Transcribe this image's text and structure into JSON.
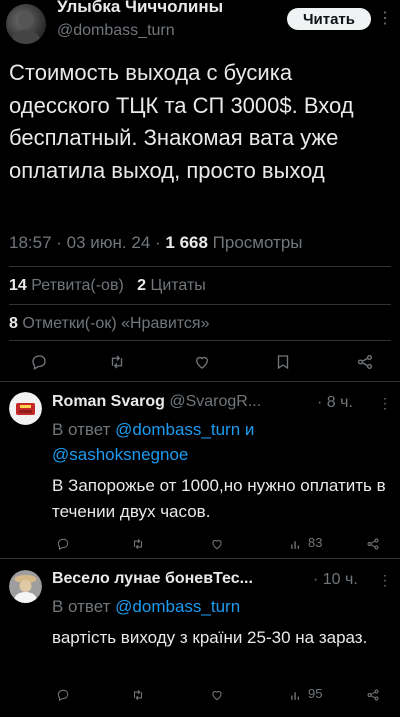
{
  "tweet": {
    "author_name": "Улыбка Чиччолины",
    "author_handle": "@dombass_turn",
    "read_button": "Читать",
    "text": "Стоимость выхода с бусика одесского ТЦК та СП 3000$. Вход бесплатный. Знакомая вата уже оплатила выход, просто выход",
    "time": "18:57 · 03 июн. 24 · ",
    "views_count": "1 668",
    "views_label": " Просмотры",
    "retweets_count": "14",
    "retweets_label": " Ретвита(-ов)",
    "quotes_count": "2",
    "quotes_label": " Цитаты",
    "likes_count": "8",
    "likes_label": " Отметки(-ок) «Нравится»"
  },
  "replies": [
    {
      "name": "Roman Svarog",
      "handle": " @SvarogR...",
      "time": "· 8 ч.",
      "reply_to_prefix": "В ответ ",
      "reply_to_1": "@dombass_turn",
      "reply_to_and": " и",
      "reply_to_2": "@sashoksnegnoe",
      "text": "В Запорожье от 1000,но нужно оплатить в течении двух часов.",
      "views": "83"
    },
    {
      "name": "Весело лунае боневТес...",
      "handle": "",
      "time": "· 10 ч.",
      "reply_to_prefix": "В ответ ",
      "reply_to_1": "@dombass_turn",
      "text": "вартість виходу з країни 25-30 на зараз.",
      "views": "95"
    }
  ],
  "colors": {
    "background": "#000000",
    "text": "#e7e9ea",
    "secondary": "#71767b",
    "link": "#1d9bf0",
    "divider": "#2f3336"
  },
  "icons": [
    "reply-icon",
    "retweet-icon",
    "like-icon",
    "bookmark-icon",
    "share-icon",
    "views-icon",
    "more-icon"
  ]
}
